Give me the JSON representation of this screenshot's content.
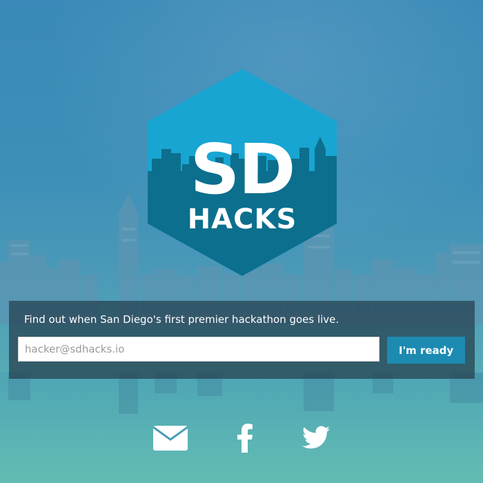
{
  "logo": {
    "top_text": "SD",
    "bottom_text": "HACKS",
    "colors": {
      "hex_top": "#18a5d2",
      "hex_bottom": "#0c6f8e",
      "skyline": "#0c6f8e",
      "text": "#ffffff"
    }
  },
  "signup": {
    "tagline": "Find out when San Diego's first premier hackathon goes live.",
    "email_placeholder": "hacker@sdhacks.io",
    "email_value": "",
    "button_label": "I'm ready",
    "colors": {
      "panel": "#263e4e",
      "button": "#1d8bb1"
    }
  },
  "social": [
    {
      "icon": "mail-icon"
    },
    {
      "icon": "facebook-icon"
    },
    {
      "icon": "twitter-icon"
    }
  ]
}
